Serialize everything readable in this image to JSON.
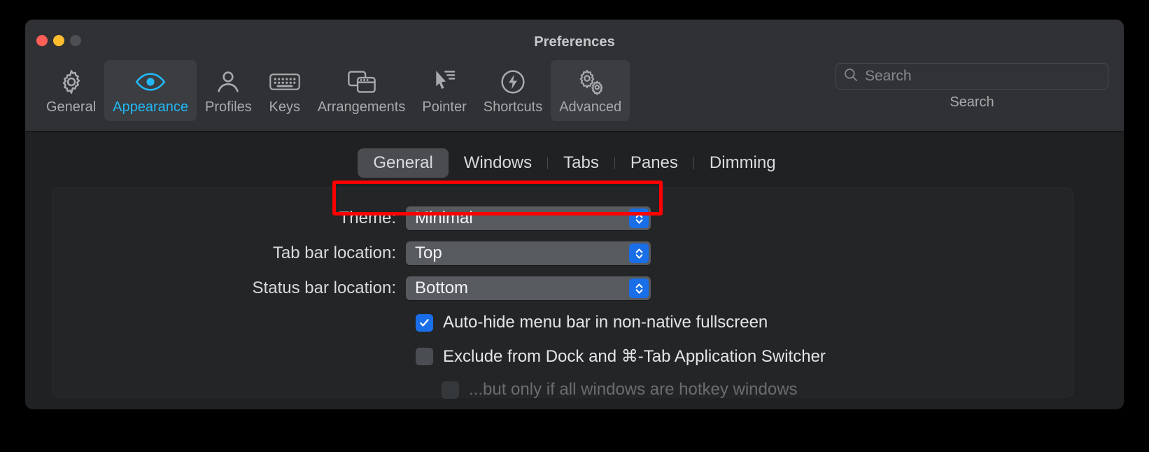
{
  "window": {
    "title": "Preferences",
    "traffic_lights": [
      "close-button",
      "minimize-button",
      "zoom-button"
    ]
  },
  "toolbar": {
    "items": [
      {
        "label": "General",
        "icon": "gear-icon",
        "state": "normal"
      },
      {
        "label": "Appearance",
        "icon": "eye-icon",
        "state": "selected"
      },
      {
        "label": "Profiles",
        "icon": "person-icon",
        "state": "normal"
      },
      {
        "label": "Keys",
        "icon": "keyboard-icon",
        "state": "normal"
      },
      {
        "label": "Arrangements",
        "icon": "windows-icon",
        "state": "normal"
      },
      {
        "label": "Pointer",
        "icon": "cursor-icon",
        "state": "normal"
      },
      {
        "label": "Shortcuts",
        "icon": "bolt-circle-icon",
        "state": "normal"
      },
      {
        "label": "Advanced",
        "icon": "gears-icon",
        "state": "hovered"
      }
    ],
    "search": {
      "icon": "search-icon",
      "placeholder": "Search",
      "value": "",
      "sublabel": "Search"
    }
  },
  "tabs": {
    "items": [
      "General",
      "Windows",
      "Tabs",
      "Panes",
      "Dimming"
    ],
    "selected": "General"
  },
  "form": {
    "theme": {
      "label": "Theme:",
      "value": "Minimal",
      "chevron": "chevron-up-down-icon"
    },
    "tab_bar_location": {
      "label": "Tab bar location:",
      "value": "Top",
      "chevron": "chevron-up-down-icon"
    },
    "status_bar_location": {
      "label": "Status bar location:",
      "value": "Bottom",
      "chevron": "chevron-up-down-icon"
    },
    "checkboxes": [
      {
        "label": "Auto-hide menu bar in non-native fullscreen",
        "checked": true,
        "disabled": false,
        "indent": false
      },
      {
        "label": "Exclude from Dock and ⌘-Tab Application Switcher",
        "checked": false,
        "disabled": false,
        "indent": false
      },
      {
        "label": "...but only if all windows are hotkey windows",
        "checked": false,
        "disabled": true,
        "indent": true
      }
    ]
  },
  "annotation": {
    "color": "#ff0000",
    "target": "theme-row"
  },
  "colors": {
    "accent": "#22b8f4",
    "control_blue": "#1a6ee8",
    "toolbar_bg": "#2f3134",
    "content_bg": "#1f2123",
    "panel_bg": "#232527",
    "popup_bg": "#575a5e",
    "close": "#ff5f57",
    "minimize": "#febc2e",
    "zoom": "#4d4f52"
  }
}
